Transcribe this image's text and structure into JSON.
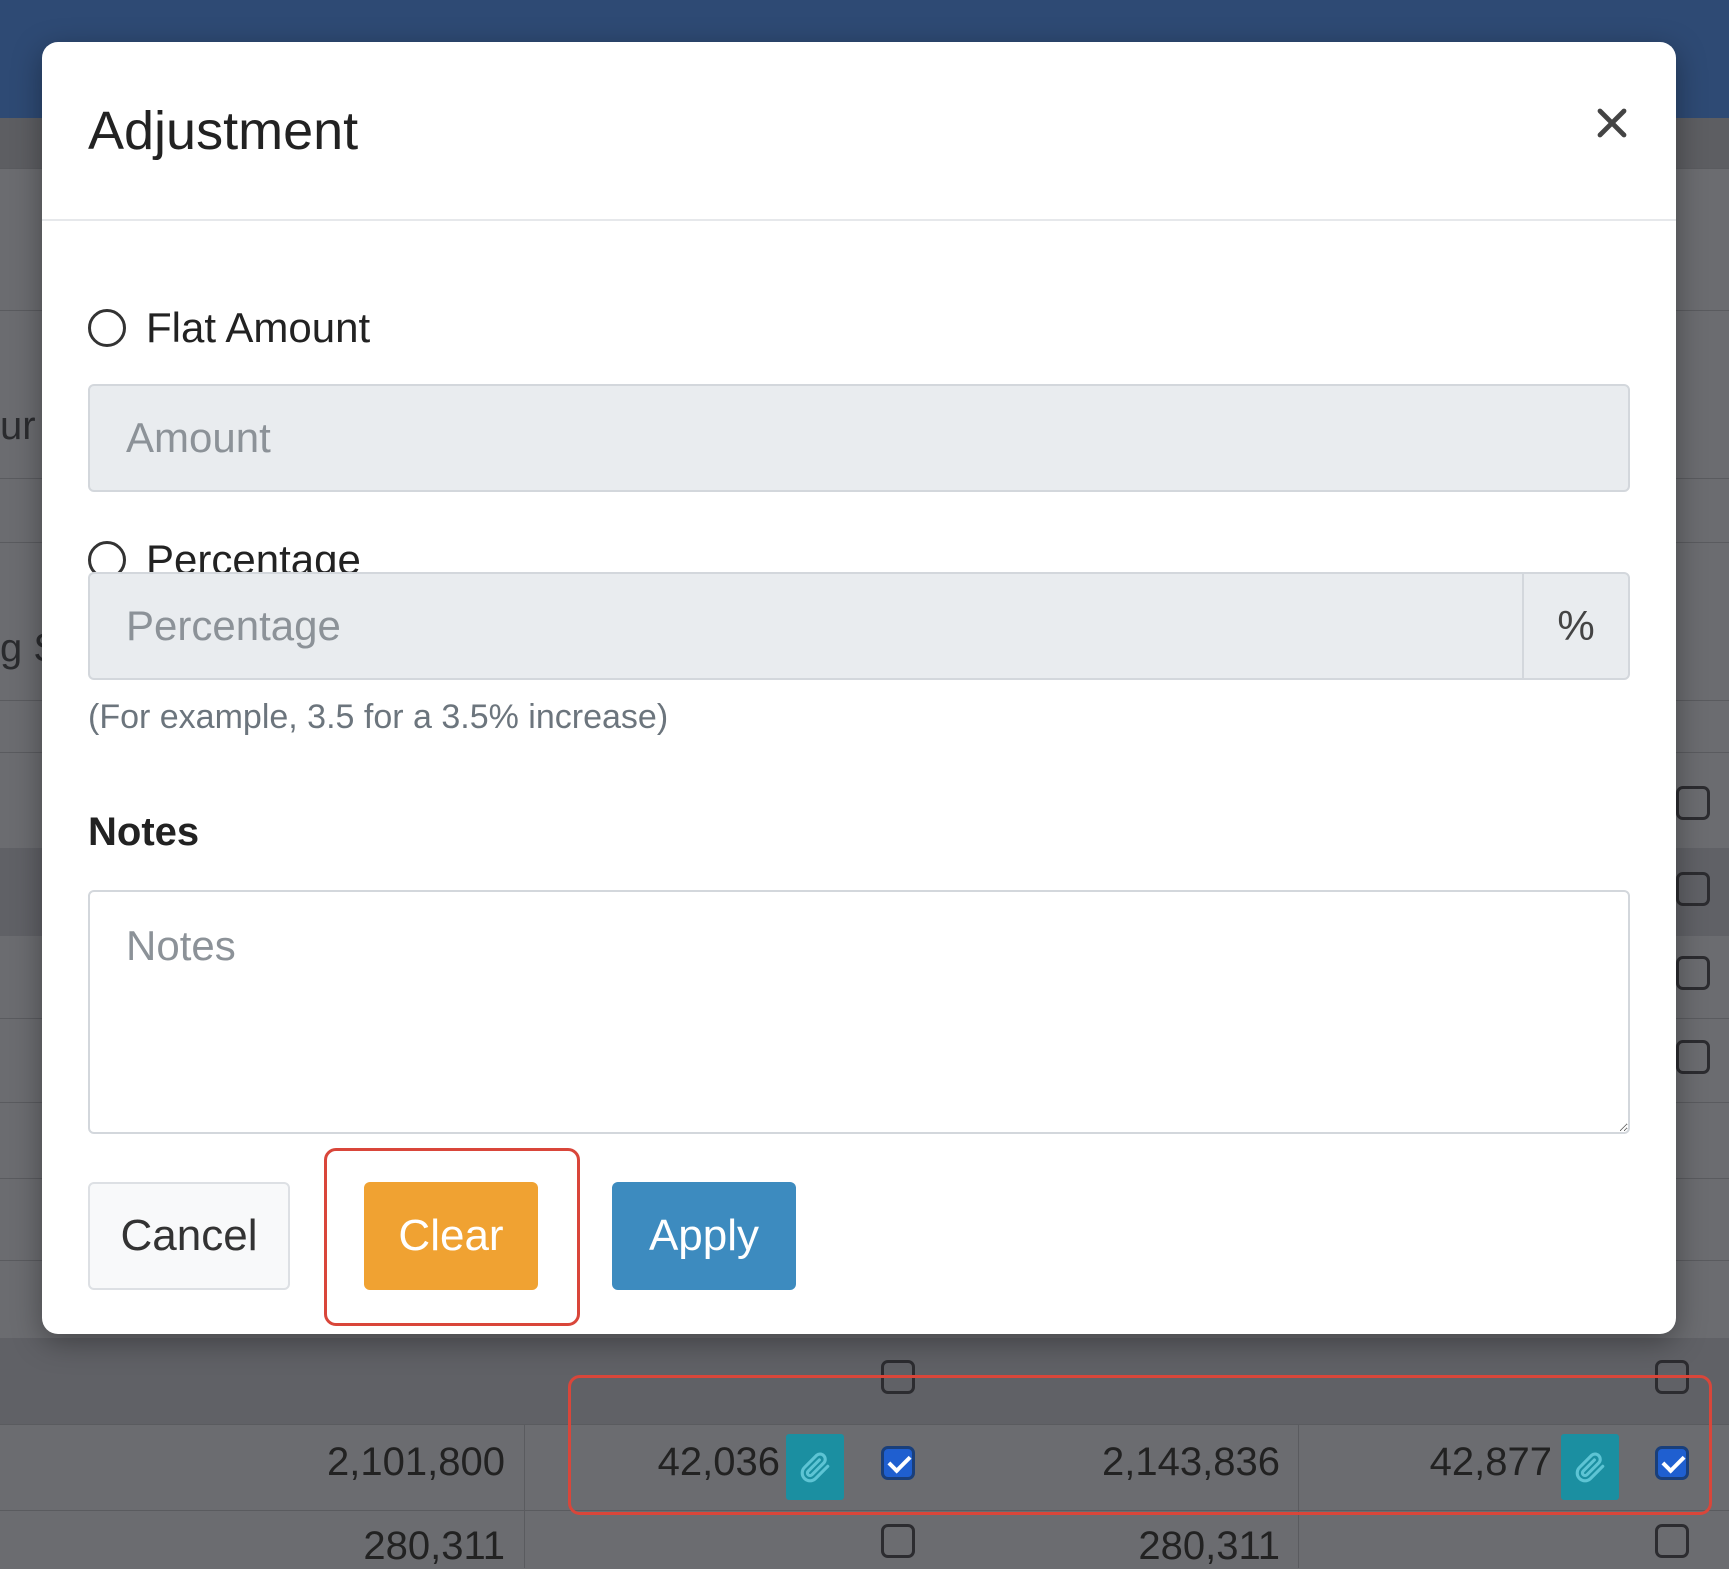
{
  "modal": {
    "title": "Adjustment",
    "close_icon": "close-icon",
    "flat_amount": {
      "label": "Flat Amount",
      "placeholder": "Amount",
      "selected": false
    },
    "percentage": {
      "label": "Percentage",
      "placeholder": "Percentage",
      "addon": "%",
      "selected": false
    },
    "help_text": "(For example, 3.5 for a 3.5% increase)",
    "notes": {
      "label": "Notes",
      "placeholder": "Notes"
    },
    "buttons": {
      "cancel": "Cancel",
      "clear": "Clear",
      "apply": "Apply"
    },
    "colors": {
      "clear": "#f0a232",
      "apply": "#3d8bbf",
      "highlight": "#d9463a"
    }
  },
  "background": {
    "fragments": [
      "ur",
      "g S"
    ],
    "rows": [
      {
        "col1": "2,101,800",
        "col2": "42,036",
        "col2_checked": true,
        "col3": "2,143,836",
        "col4": "42,877",
        "col4_checked": true
      },
      {
        "col1": "280,311",
        "col2_checked": false,
        "col3": "280,311",
        "col4_checked": false
      }
    ],
    "attach_icon": "paperclip-icon"
  }
}
